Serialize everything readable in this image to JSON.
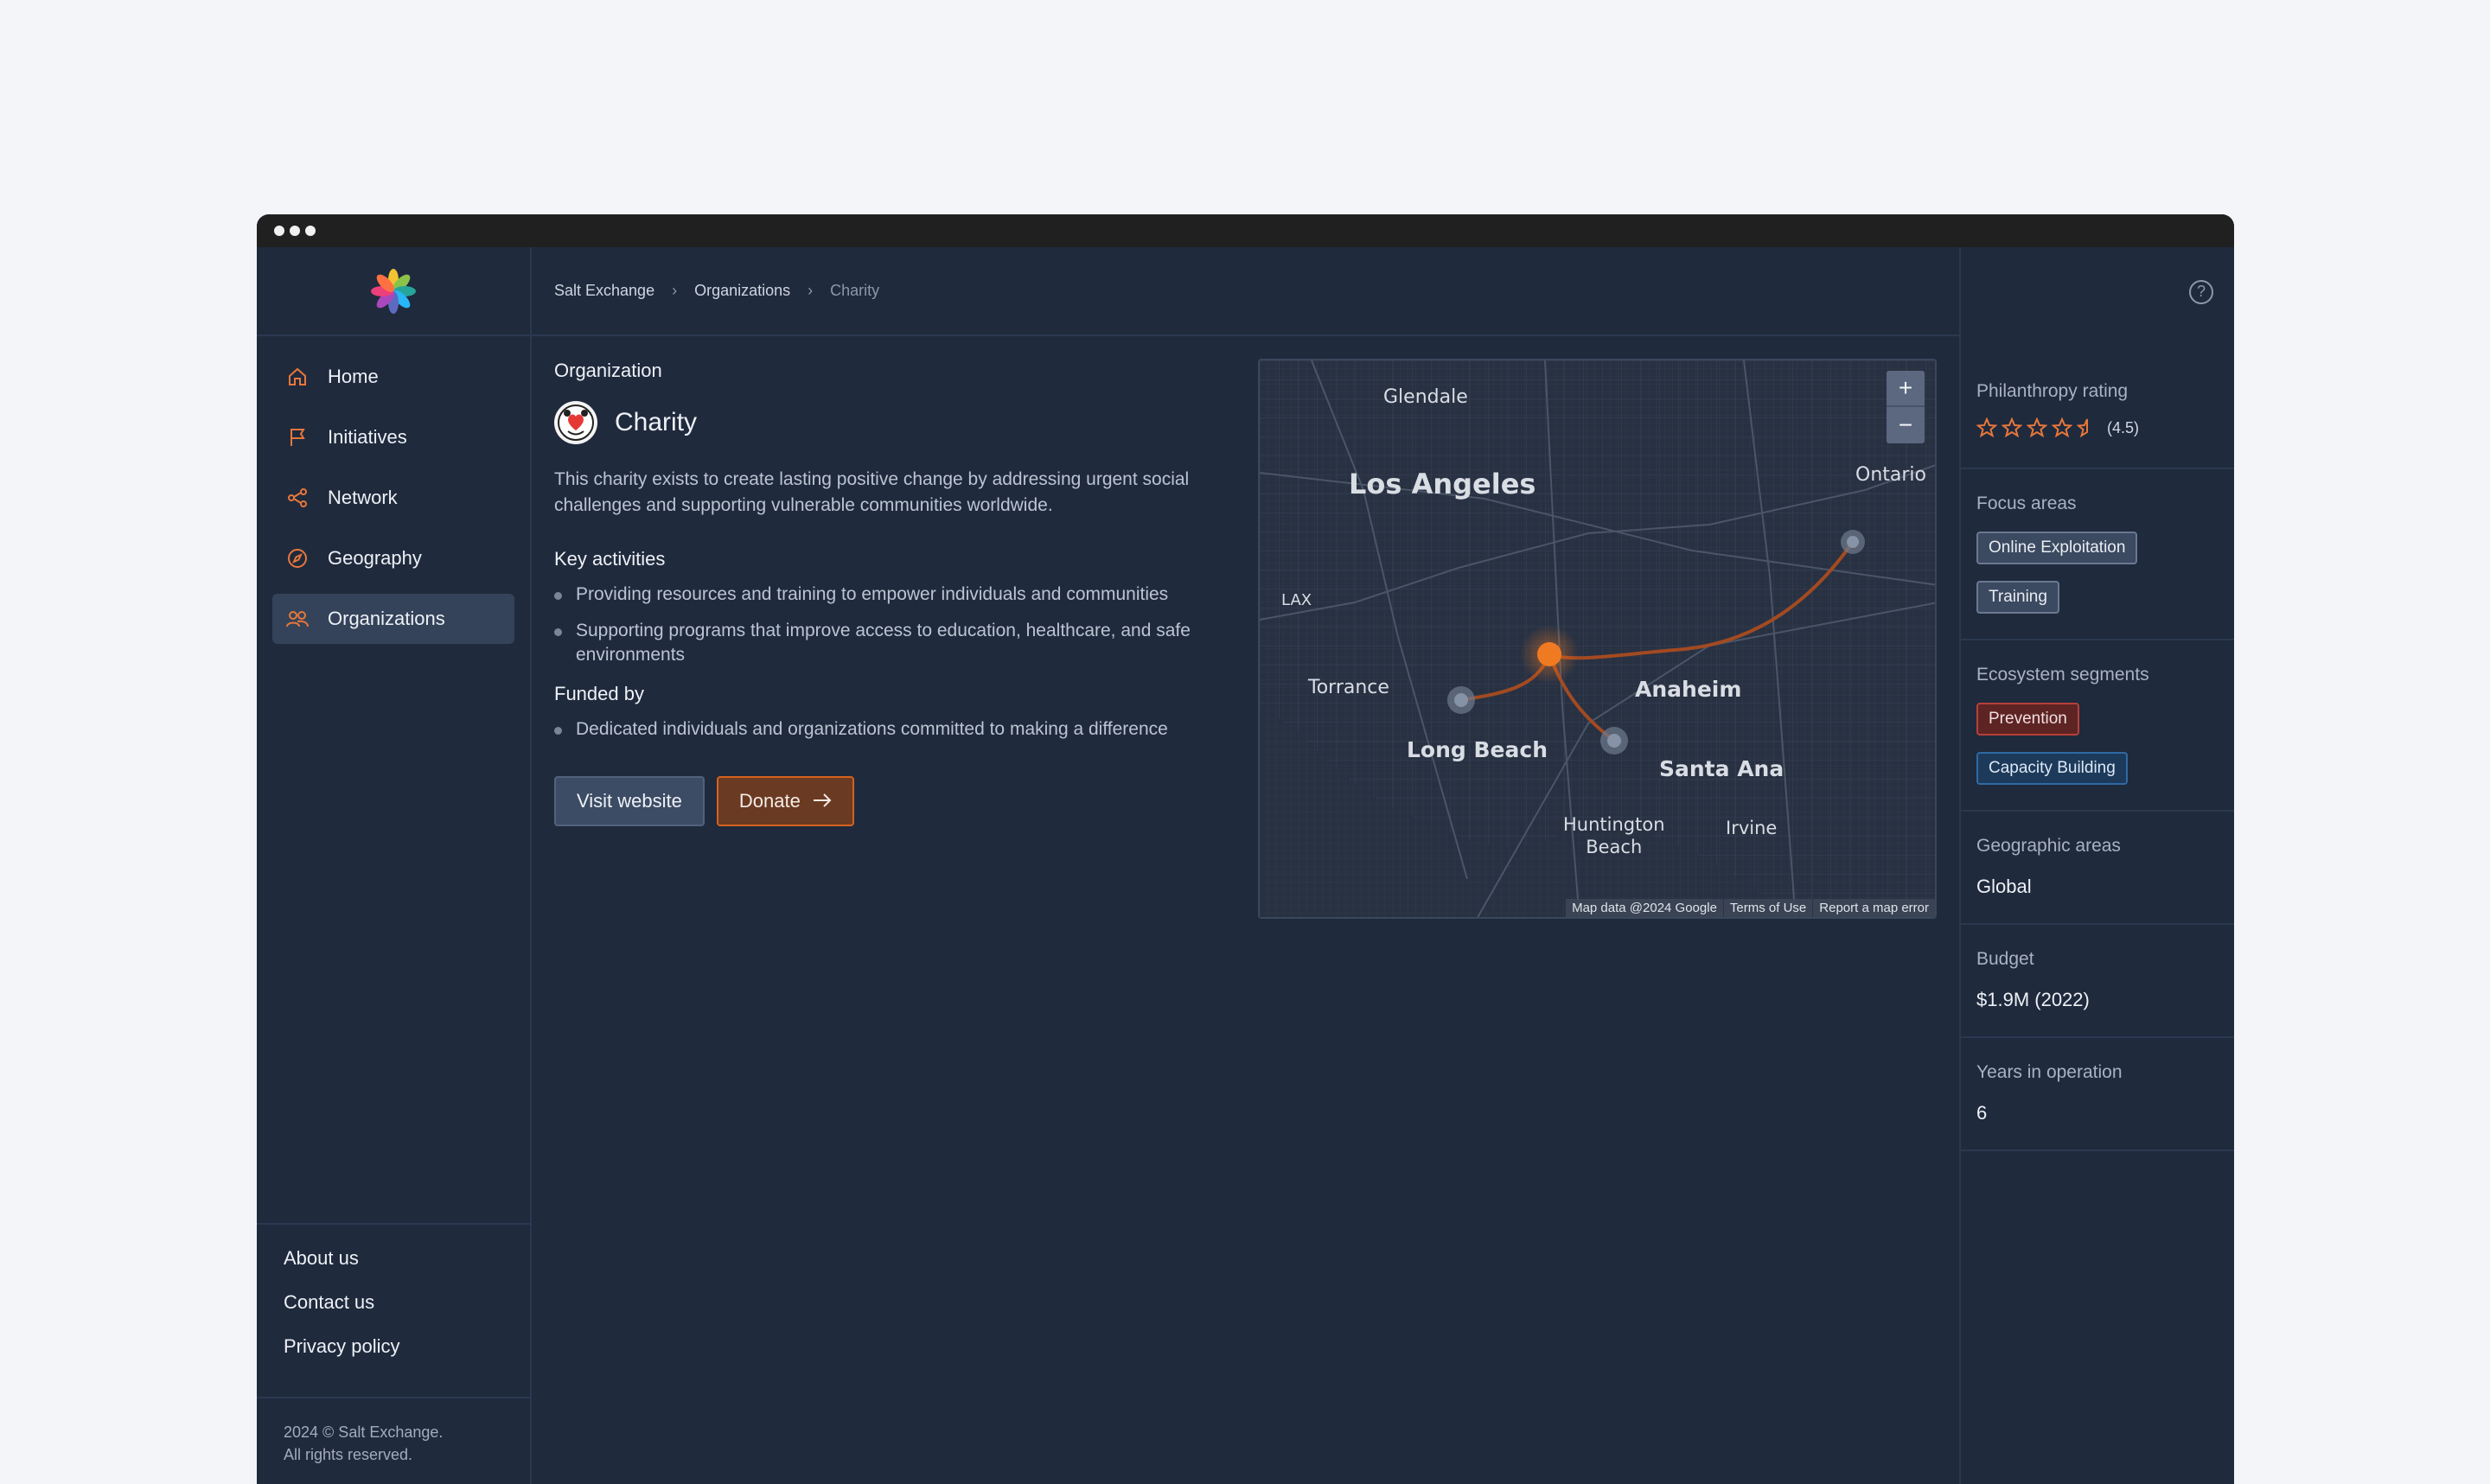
{
  "window": {
    "controls": [
      "dot",
      "dot",
      "dot"
    ]
  },
  "sidebar": {
    "logo": "pinwheel-logo",
    "items": [
      {
        "label": "Home",
        "icon": "home-icon",
        "active": false
      },
      {
        "label": "Initiatives",
        "icon": "flag-icon",
        "active": false
      },
      {
        "label": "Network",
        "icon": "share-icon",
        "active": false
      },
      {
        "label": "Geography",
        "icon": "compass-icon",
        "active": false
      },
      {
        "label": "Organizations",
        "icon": "people-icon",
        "active": true
      }
    ],
    "footer_links": [
      "About us",
      "Contact us",
      "Privacy policy"
    ],
    "copyright_line1": "2024 © Salt Exchange.",
    "copyright_line2": "All rights reserved."
  },
  "breadcrumb": [
    "Salt Exchange",
    "Organizations",
    "Charity"
  ],
  "org": {
    "section_label": "Organization",
    "name": "Charity",
    "description": "This charity exists to create lasting positive change by addressing urgent social challenges and supporting vulnerable communities worldwide.",
    "key_activities_title": "Key activities",
    "key_activities": [
      "Providing resources and training to empower individuals and communities",
      "Supporting programs that improve access to education, healthcare, and safe environments"
    ],
    "funded_by_title": "Funded by",
    "funded_by": [
      "Dedicated individuals and organizations committed to making a difference"
    ],
    "visit_label": "Visit website",
    "donate_label": "Donate"
  },
  "map": {
    "labels": {
      "glendale": "Glendale",
      "los_angeles": "Los Angeles",
      "ontario": "Ontario",
      "lax": "LAX",
      "torrance": "Torrance",
      "anaheim": "Anaheim",
      "long_beach": "Long Beach",
      "santa_ana": "Santa Ana",
      "huntington_beach": "Huntington\nBeach",
      "irvine": "Irvine"
    },
    "zoom_in": "+",
    "zoom_out": "−",
    "attribution": [
      "Map data @2024 Google",
      "Terms of Use",
      "Report a map error"
    ],
    "accent": "#f07a22"
  },
  "details": {
    "rating_label": "Philanthropy rating",
    "rating_value": 4.5,
    "rating_text": "(4.5)",
    "focus_label": "Focus areas",
    "focus_tags": [
      "Online Exploitation",
      "Training"
    ],
    "segments_label": "Ecosystem segments",
    "segments": [
      "Prevention",
      "Capacity Building"
    ],
    "geo_label": "Geographic areas",
    "geo_value": "Global",
    "budget_label": "Budget",
    "budget_value": "$1.9M (2022)",
    "years_label": "Years in operation",
    "years_value": "6"
  }
}
